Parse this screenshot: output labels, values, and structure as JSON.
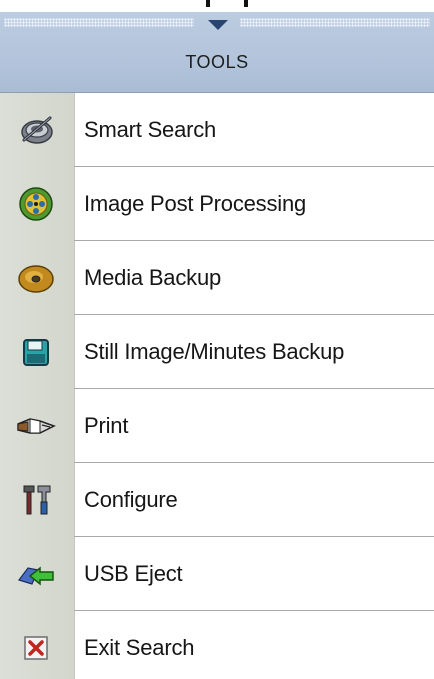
{
  "header": {
    "title": "TOOLS"
  },
  "menu": {
    "items": [
      {
        "label": "Smart Search",
        "icon": "smart-search-icon"
      },
      {
        "label": "Image Post Processing",
        "icon": "film-reel-icon"
      },
      {
        "label": "Media Backup",
        "icon": "disc-icon"
      },
      {
        "label": "Still Image/Minutes Backup",
        "icon": "floppy-disk-icon"
      },
      {
        "label": "Print",
        "icon": "printer-hand-icon"
      },
      {
        "label": "Configure",
        "icon": "tools-icon"
      },
      {
        "label": "USB Eject",
        "icon": "usb-eject-icon"
      },
      {
        "label": "Exit Search",
        "icon": "close-icon"
      }
    ]
  },
  "colors": {
    "header_bg": "#b1c3da",
    "icon_column_bg": "#d8dbd2",
    "separator": "#a8a8a8",
    "arrow": "#27456f"
  }
}
